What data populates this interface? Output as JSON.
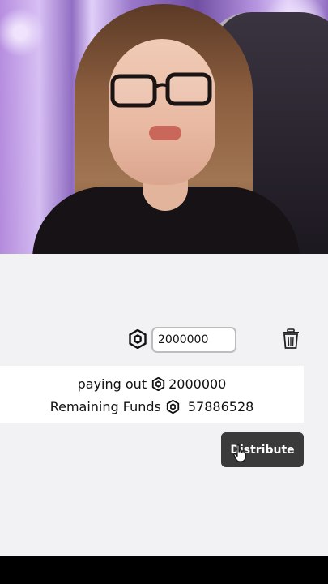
{
  "payout": {
    "amount_input_value": "2000000"
  },
  "summary": {
    "paying_out_label": "paying out",
    "paying_out_value": "2000000",
    "remaining_label": "Remaining Funds",
    "remaining_value": "57886528"
  },
  "actions": {
    "distribute_label": "Distribute"
  },
  "icons": {
    "currency": "robux-icon",
    "delete": "trash-icon",
    "pointer": "hand-cursor-icon"
  },
  "colors": {
    "panel_bg": "#f2f2f4",
    "button_bg": "#3a3a3a",
    "button_text": "#ffffff"
  }
}
